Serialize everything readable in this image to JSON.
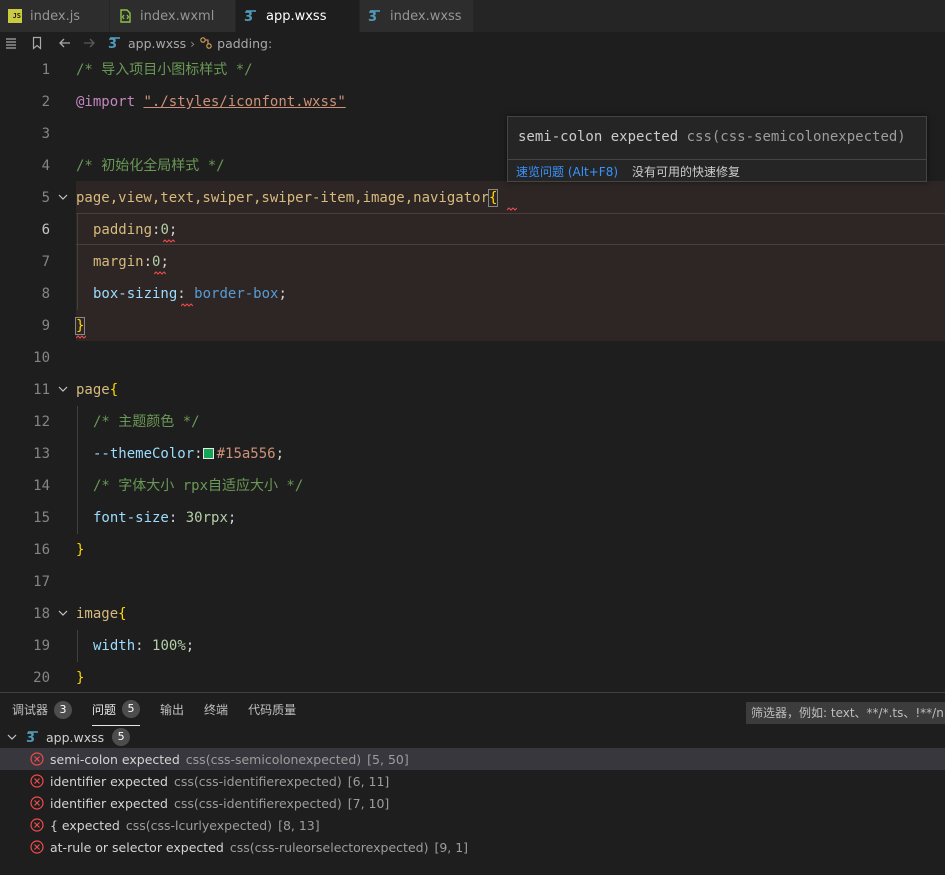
{
  "tabs": [
    {
      "label": "index.js",
      "icon": "js-file-icon",
      "active": false
    },
    {
      "label": "index.wxml",
      "icon": "wxml-file-icon",
      "active": false
    },
    {
      "label": "app.wxss",
      "icon": "css-file-icon",
      "active": true,
      "modified": true
    },
    {
      "label": "index.wxss",
      "icon": "css-file-icon",
      "active": false
    }
  ],
  "breadcrumb": {
    "file": "app.wxss",
    "symbol": "padding:"
  },
  "editor": {
    "lines": [
      "1",
      "2",
      "3",
      "4",
      "5",
      "6",
      "7",
      "8",
      "9",
      "10",
      "11",
      "12",
      "13",
      "14",
      "15",
      "16",
      "17",
      "18",
      "19",
      "20"
    ],
    "comment1": "/* 导入项目小图标样式 */",
    "import_kw": "@import",
    "import_path": "\"./styles/iconfont.wxss\"",
    "comment2": "/* 初始化全局样式 */",
    "selector1": "page,view,text,swiper,swiper-item,image,navigator",
    "padding_prop": "padding",
    "padding_val": "0",
    "margin_prop": "margin",
    "margin_val": "0",
    "boxsizing_prop": "box-sizing",
    "boxsizing_val": "border-box",
    "selector2": "page",
    "comment3": "/* 主题颜色 */",
    "theme_var": "--themeColor",
    "theme_val": "#15a556",
    "comment4": "/* 字体大小 rpx自适应大小 */",
    "fontsize_prop": "font-size",
    "fontsize_val": "30rpx",
    "selector3": "image",
    "width_prop": "width",
    "width_val": "100%",
    "open_brace": "{",
    "close_brace": "}",
    "colon": ":",
    "semi": ";"
  },
  "tooltip": {
    "message": "semi-colon expected",
    "source": "css(css-semicolonexpected)",
    "view_problem": "速览问题 (Alt+F8)",
    "no_fix": "没有可用的快速修复"
  },
  "panel": {
    "tabs": [
      {
        "label": "调试器",
        "badge": "3"
      },
      {
        "label": "问题",
        "badge": "5",
        "active": true
      },
      {
        "label": "输出"
      },
      {
        "label": "终端"
      },
      {
        "label": "代码质量"
      }
    ],
    "filter_placeholder": "筛选器，例如: text、**/*.ts、!**/node_modules/**",
    "file": "app.wxss",
    "file_count": "5",
    "problems": [
      {
        "message": "semi-colon expected",
        "source": "css(css-semicolonexpected)",
        "location": "[5, 50]"
      },
      {
        "message": "identifier expected",
        "source": "css(css-identifierexpected)",
        "location": "[6, 11]"
      },
      {
        "message": "identifier expected",
        "source": "css(css-identifierexpected)",
        "location": "[7, 10]"
      },
      {
        "message": "{ expected",
        "source": "css(css-lcurlyexpected)",
        "location": "[8, 13]"
      },
      {
        "message": "at-rule or selector expected",
        "source": "css(css-ruleorselectorexpected)",
        "location": "[9, 1]"
      }
    ]
  },
  "colors": {
    "error": "#f14c4c",
    "accent": "#3794ff",
    "theme_swatch": "#15a556"
  }
}
